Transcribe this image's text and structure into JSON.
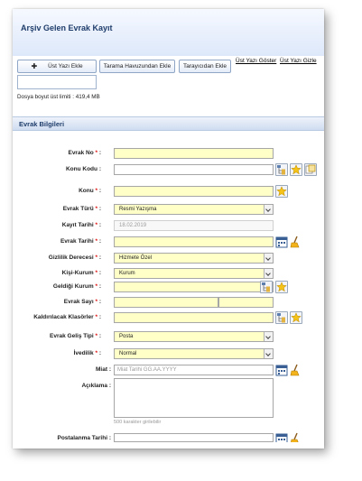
{
  "header": {
    "title": "Arşiv Gelen Evrak Kayıt"
  },
  "toolbar": {
    "add_top_doc": "Üst Yazı Ekle",
    "add_from_scan_pool": "Tarama Havuzundan Ekle",
    "add_from_scanner": "Tarayıcıdan Ekle",
    "show_top_doc": "Üst Yazı Göster",
    "hide_top_doc": "Üst Yazı Gizle",
    "file_size_limit": "Dosya boyut üst limiti : 419,4 MB"
  },
  "section": {
    "title": "Evrak Bilgileri"
  },
  "form": {
    "evrak_no": {
      "label": "Evrak No",
      "value": ""
    },
    "konu_kodu": {
      "label": "Konu Kodu",
      "value": ""
    },
    "konu": {
      "label": "Konu",
      "value": ""
    },
    "evrak_turu": {
      "label": "Evrak Türü",
      "value": "Resmi Yazışma"
    },
    "kayit_tarihi": {
      "label": "Kayıt Tarihi",
      "value": "18.02.2019"
    },
    "evrak_tarihi": {
      "label": "Evrak Tarihi",
      "value": ""
    },
    "gizlilik": {
      "label": "Gizlilik Derecesi",
      "value": "Hizmete Özel"
    },
    "kisi_kurum": {
      "label": "Kişi-Kurum",
      "value": "Kurum"
    },
    "geldigi_kurum": {
      "label": "Geldiği Kurum",
      "value": ""
    },
    "evrak_sayi": {
      "label": "Evrak Sayı",
      "value": ""
    },
    "kaldirilacak_klasorler": {
      "label": "Kaldırılacak Klasörler",
      "value": ""
    },
    "evrak_gelis_tipi": {
      "label": "Evrak Geliş Tipi",
      "value": "Posta"
    },
    "ivedilik": {
      "label": "İvedilik",
      "value": "Normal"
    },
    "miat": {
      "label": "Miat",
      "placeholder": "Miat Tarihi GG.AA.YYYY"
    },
    "aciklama": {
      "label": "Açıklama",
      "hint": "500 karakter girilebilir"
    },
    "postalanma_tarihi": {
      "label": "Postalanma Tarihi",
      "value": ""
    }
  },
  "icons": {
    "tree": "tree-picker-icon",
    "star": "favorite-star-icon",
    "copy": "copy-icon",
    "calendar": "calendar-icon",
    "clear": "broom-clear-icon"
  },
  "colors": {
    "required_field": "#ffffc8",
    "required_star": "#e01010",
    "title": "#1f3d6b",
    "header_bg": "#dde8fa"
  }
}
